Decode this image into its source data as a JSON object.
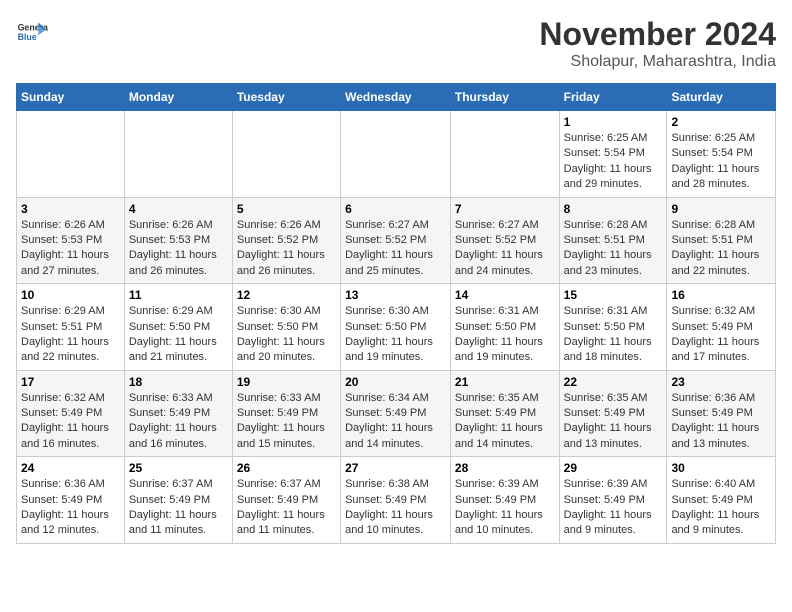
{
  "logo": {
    "general": "General",
    "blue": "Blue"
  },
  "title": "November 2024",
  "location": "Sholapur, Maharashtra, India",
  "headers": [
    "Sunday",
    "Monday",
    "Tuesday",
    "Wednesday",
    "Thursday",
    "Friday",
    "Saturday"
  ],
  "weeks": [
    [
      {
        "day": "",
        "info": ""
      },
      {
        "day": "",
        "info": ""
      },
      {
        "day": "",
        "info": ""
      },
      {
        "day": "",
        "info": ""
      },
      {
        "day": "",
        "info": ""
      },
      {
        "day": "1",
        "info": "Sunrise: 6:25 AM\nSunset: 5:54 PM\nDaylight: 11 hours and 29 minutes."
      },
      {
        "day": "2",
        "info": "Sunrise: 6:25 AM\nSunset: 5:54 PM\nDaylight: 11 hours and 28 minutes."
      }
    ],
    [
      {
        "day": "3",
        "info": "Sunrise: 6:26 AM\nSunset: 5:53 PM\nDaylight: 11 hours and 27 minutes."
      },
      {
        "day": "4",
        "info": "Sunrise: 6:26 AM\nSunset: 5:53 PM\nDaylight: 11 hours and 26 minutes."
      },
      {
        "day": "5",
        "info": "Sunrise: 6:26 AM\nSunset: 5:52 PM\nDaylight: 11 hours and 26 minutes."
      },
      {
        "day": "6",
        "info": "Sunrise: 6:27 AM\nSunset: 5:52 PM\nDaylight: 11 hours and 25 minutes."
      },
      {
        "day": "7",
        "info": "Sunrise: 6:27 AM\nSunset: 5:52 PM\nDaylight: 11 hours and 24 minutes."
      },
      {
        "day": "8",
        "info": "Sunrise: 6:28 AM\nSunset: 5:51 PM\nDaylight: 11 hours and 23 minutes."
      },
      {
        "day": "9",
        "info": "Sunrise: 6:28 AM\nSunset: 5:51 PM\nDaylight: 11 hours and 22 minutes."
      }
    ],
    [
      {
        "day": "10",
        "info": "Sunrise: 6:29 AM\nSunset: 5:51 PM\nDaylight: 11 hours and 22 minutes."
      },
      {
        "day": "11",
        "info": "Sunrise: 6:29 AM\nSunset: 5:50 PM\nDaylight: 11 hours and 21 minutes."
      },
      {
        "day": "12",
        "info": "Sunrise: 6:30 AM\nSunset: 5:50 PM\nDaylight: 11 hours and 20 minutes."
      },
      {
        "day": "13",
        "info": "Sunrise: 6:30 AM\nSunset: 5:50 PM\nDaylight: 11 hours and 19 minutes."
      },
      {
        "day": "14",
        "info": "Sunrise: 6:31 AM\nSunset: 5:50 PM\nDaylight: 11 hours and 19 minutes."
      },
      {
        "day": "15",
        "info": "Sunrise: 6:31 AM\nSunset: 5:50 PM\nDaylight: 11 hours and 18 minutes."
      },
      {
        "day": "16",
        "info": "Sunrise: 6:32 AM\nSunset: 5:49 PM\nDaylight: 11 hours and 17 minutes."
      }
    ],
    [
      {
        "day": "17",
        "info": "Sunrise: 6:32 AM\nSunset: 5:49 PM\nDaylight: 11 hours and 16 minutes."
      },
      {
        "day": "18",
        "info": "Sunrise: 6:33 AM\nSunset: 5:49 PM\nDaylight: 11 hours and 16 minutes."
      },
      {
        "day": "19",
        "info": "Sunrise: 6:33 AM\nSunset: 5:49 PM\nDaylight: 11 hours and 15 minutes."
      },
      {
        "day": "20",
        "info": "Sunrise: 6:34 AM\nSunset: 5:49 PM\nDaylight: 11 hours and 14 minutes."
      },
      {
        "day": "21",
        "info": "Sunrise: 6:35 AM\nSunset: 5:49 PM\nDaylight: 11 hours and 14 minutes."
      },
      {
        "day": "22",
        "info": "Sunrise: 6:35 AM\nSunset: 5:49 PM\nDaylight: 11 hours and 13 minutes."
      },
      {
        "day": "23",
        "info": "Sunrise: 6:36 AM\nSunset: 5:49 PM\nDaylight: 11 hours and 13 minutes."
      }
    ],
    [
      {
        "day": "24",
        "info": "Sunrise: 6:36 AM\nSunset: 5:49 PM\nDaylight: 11 hours and 12 minutes."
      },
      {
        "day": "25",
        "info": "Sunrise: 6:37 AM\nSunset: 5:49 PM\nDaylight: 11 hours and 11 minutes."
      },
      {
        "day": "26",
        "info": "Sunrise: 6:37 AM\nSunset: 5:49 PM\nDaylight: 11 hours and 11 minutes."
      },
      {
        "day": "27",
        "info": "Sunrise: 6:38 AM\nSunset: 5:49 PM\nDaylight: 11 hours and 10 minutes."
      },
      {
        "day": "28",
        "info": "Sunrise: 6:39 AM\nSunset: 5:49 PM\nDaylight: 11 hours and 10 minutes."
      },
      {
        "day": "29",
        "info": "Sunrise: 6:39 AM\nSunset: 5:49 PM\nDaylight: 11 hours and 9 minutes."
      },
      {
        "day": "30",
        "info": "Sunrise: 6:40 AM\nSunset: 5:49 PM\nDaylight: 11 hours and 9 minutes."
      }
    ]
  ]
}
